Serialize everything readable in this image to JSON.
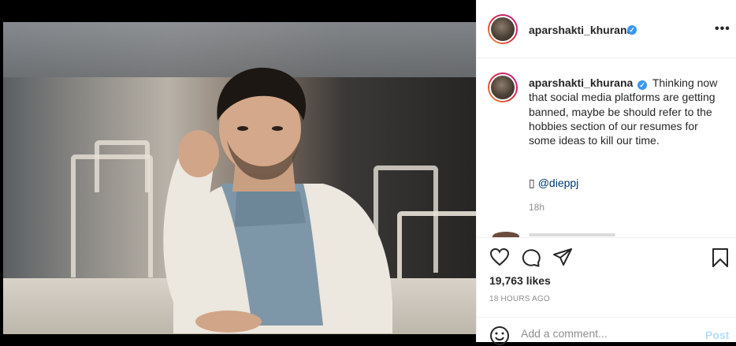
{
  "post": {
    "username": "aparshakti_khurana",
    "verified_glyph": "✓",
    "more_glyph": "•••"
  },
  "caption": {
    "username": "aparshakti_khurana",
    "text": "Thinking now that social media platforms are getting banned, maybe be should refer to the hobbies section of our resumes for some ideas to kill our time.",
    "credit_glyph": "▯",
    "credit_handle": "@dieppj",
    "time": "18h"
  },
  "actions": {
    "like_icon": "heart-icon",
    "comment_icon": "comment-icon",
    "share_icon": "share-icon",
    "save_icon": "bookmark-icon"
  },
  "likes": "19,763 likes",
  "posted_ago": "18 HOURS AGO",
  "comment_box": {
    "placeholder": "Add a comment...",
    "post_label": "Post"
  },
  "colors": {
    "verified_blue": "#3897f0",
    "post_button": "#b2dffc",
    "mention_link": "#00376b"
  }
}
